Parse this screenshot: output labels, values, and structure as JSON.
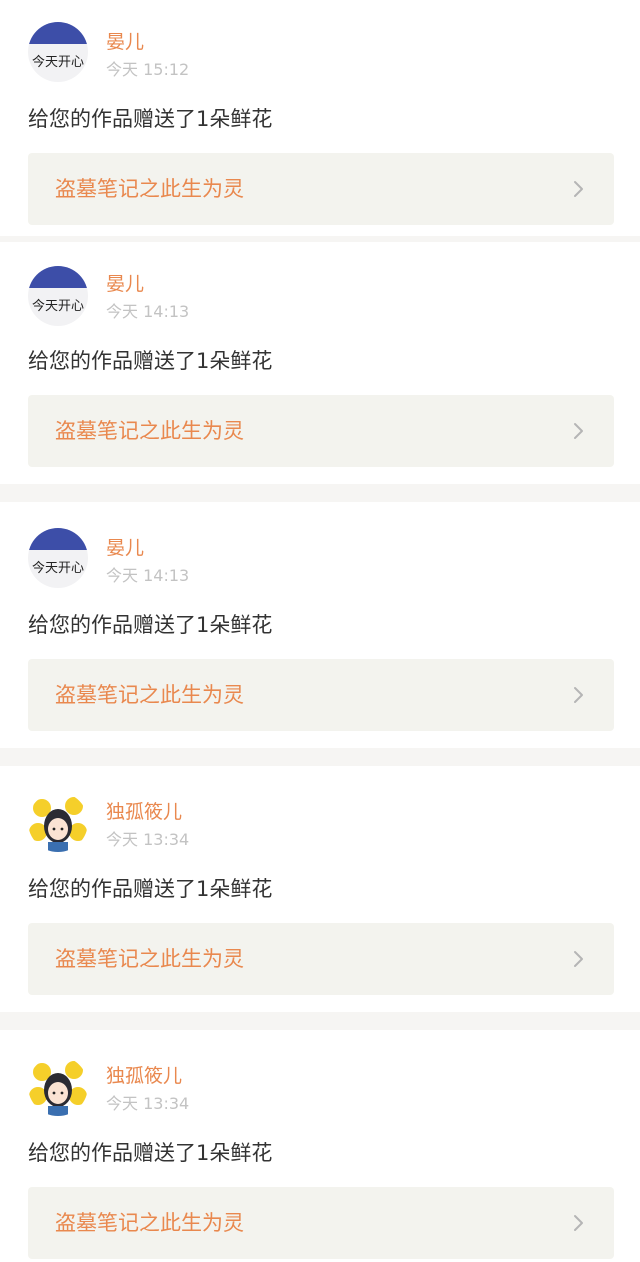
{
  "notifications": [
    {
      "username": "晏儿",
      "time": "今天 15:12",
      "avatar": "text-avatar-icon",
      "avatar_text": "今天开心",
      "message": "给您的作品赠送了1朵鲜花",
      "work_title": "盗墓笔记之此生为灵"
    },
    {
      "username": "晏儿",
      "time": "今天 14:13",
      "avatar": "text-avatar-icon",
      "avatar_text": "今天开心",
      "message": "给您的作品赠送了1朵鲜花",
      "work_title": "盗墓笔记之此生为灵"
    },
    {
      "username": "晏儿",
      "time": "今天 14:13",
      "avatar": "text-avatar-icon",
      "avatar_text": "今天开心",
      "message": "给您的作品赠送了1朵鲜花",
      "work_title": "盗墓笔记之此生为灵"
    },
    {
      "username": "独孤筱儿",
      "time": "今天 13:34",
      "avatar": "cartoon-girl-avatar-icon",
      "message": "给您的作品赠送了1朵鲜花",
      "work_title": "盗墓笔记之此生为灵"
    },
    {
      "username": "独孤筱儿",
      "time": "今天 13:34",
      "avatar": "cartoon-girl-avatar-icon",
      "message": "给您的作品赠送了1朵鲜花",
      "work_title": "盗墓笔记之此生为灵"
    }
  ],
  "colors": {
    "accent": "#e9884e",
    "time": "#c3c3c3",
    "text": "#333333",
    "link_bg": "#f3f3ee",
    "page_bg": "#f6f5f3"
  }
}
